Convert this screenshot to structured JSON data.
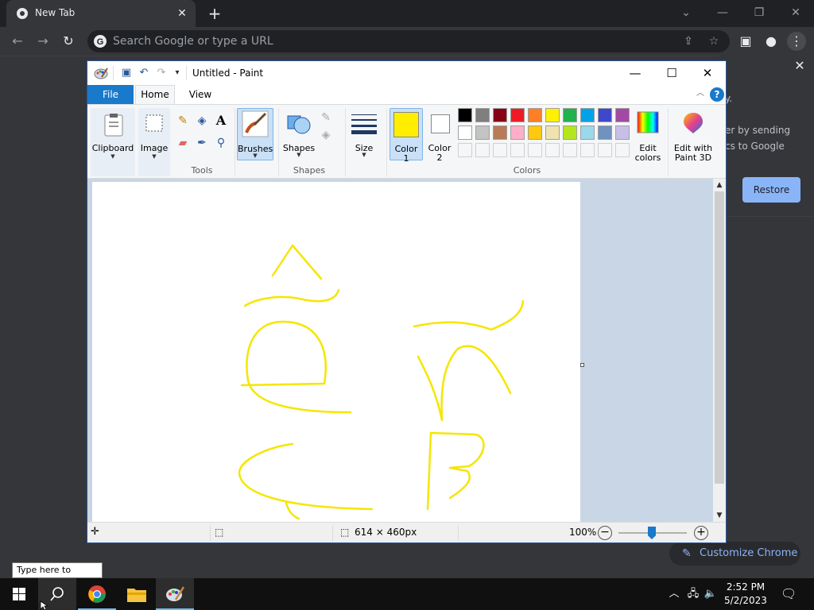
{
  "chrome": {
    "tab_title": "New Tab",
    "new_tab_symbol": "+",
    "omnibox_placeholder": "Search Google or type a URL",
    "notice_line1": "y.",
    "notice_line2": "er by sending",
    "notice_line3": "cs to Google",
    "restore_label": "Restore",
    "customize_label": "Customize Chrome"
  },
  "paint": {
    "window_title": "Untitled - Paint",
    "tabs": {
      "file": "File",
      "home": "Home",
      "view": "View"
    },
    "ribbon": {
      "clipboard": "Clipboard",
      "image": "Image",
      "tools_group": "Tools",
      "brushes": "Brushes",
      "shapes": "Shapes",
      "shapes_group": "Shapes",
      "size": "Size",
      "color1_line1": "Color",
      "color1_line2": "1",
      "color2_line1": "Color",
      "color2_line2": "2",
      "edit_colors_line1": "Edit",
      "edit_colors_line2": "colors",
      "paint3d_line1": "Edit with",
      "paint3d_line2": "Paint 3D",
      "colors_group": "Colors"
    },
    "color1": "#ffee00",
    "color2": "#ffffff",
    "palette_row1": [
      "#000000",
      "#7f7f7f",
      "#880015",
      "#ed1c24",
      "#ff7f27",
      "#fff200",
      "#22b14c",
      "#00a2e8",
      "#3f48cc",
      "#a349a4"
    ],
    "palette_row2": [
      "#ffffff",
      "#c3c3c3",
      "#b97a57",
      "#ffaec9",
      "#ffc90e",
      "#efe4b0",
      "#b5e61d",
      "#99d9ea",
      "#7092be",
      "#c8bfe7"
    ],
    "stroke_color": "#f5e600",
    "status": {
      "canvas_size": "614 × 460px",
      "zoom": "100%"
    }
  },
  "taskbar": {
    "search_tooltip": "Type here to search",
    "time": "2:52 PM",
    "date": "5/2/2023"
  }
}
